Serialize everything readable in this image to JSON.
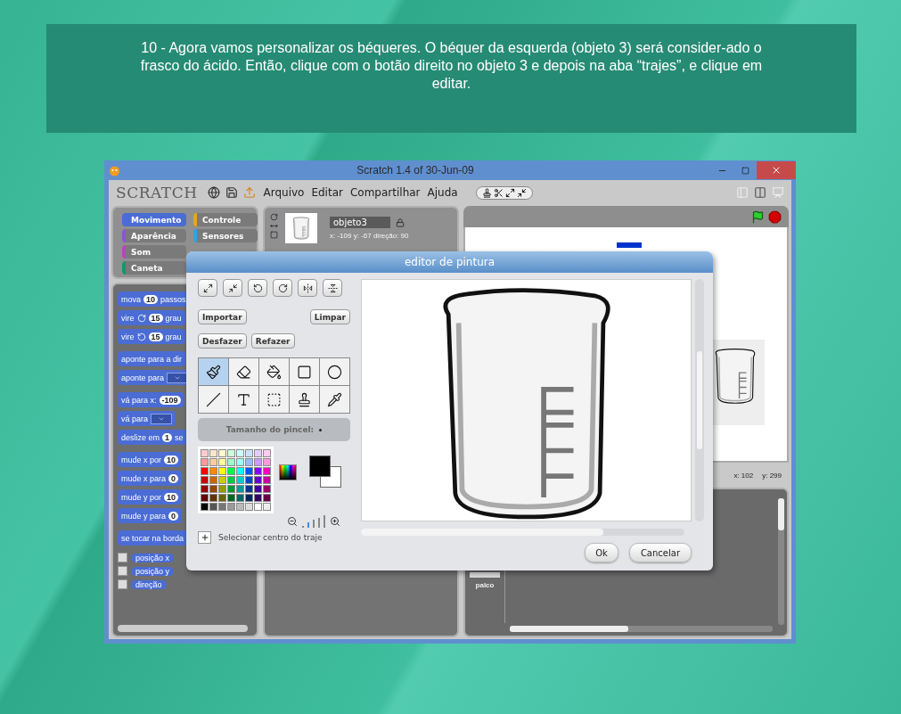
{
  "caption": "10 - Agora vamos personalizar os béqueres. O béquer da esquerda (objeto 3) será consider-ado o frasco do ácido. Então, clique com o botão direito no objeto 3 e depois na aba “trajes”, e clique em editar.",
  "window": {
    "title": "Scratch 1.4 of 30-Jun-09"
  },
  "logo": "SCRATCH",
  "menu": [
    "Arquivo",
    "Editar",
    "Compartilhar",
    "Ajuda"
  ],
  "categories": [
    {
      "label": "Movimento",
      "color": "#4a6cd4",
      "selected": true
    },
    {
      "label": "Aparência",
      "color": "#8a55d7",
      "selected": false
    },
    {
      "label": "Som",
      "color": "#bb42c3",
      "selected": false
    },
    {
      "label": "Caneta",
      "color": "#0e9a6c",
      "selected": false
    },
    {
      "label": "Controle",
      "color": "#e1a91a",
      "selected": false
    },
    {
      "label": "Sensores",
      "color": "#2ca5e2",
      "selected": false
    }
  ],
  "block_groups": [
    {
      "blocks": [
        {
          "parts": [
            {
              "kind": "text",
              "text": "mova"
            },
            {
              "kind": "input",
              "text": "10"
            },
            {
              "kind": "text",
              "text": "passos"
            }
          ]
        },
        {
          "parts": [
            {
              "kind": "text",
              "text": "vire"
            },
            {
              "kind": "turn_right"
            },
            {
              "kind": "input",
              "text": "15"
            },
            {
              "kind": "text",
              "text": "grau"
            }
          ]
        },
        {
          "parts": [
            {
              "kind": "text",
              "text": "vire"
            },
            {
              "kind": "turn_left"
            },
            {
              "kind": "input",
              "text": "15"
            },
            {
              "kind": "text",
              "text": "grau"
            }
          ]
        }
      ]
    },
    {
      "blocks": [
        {
          "parts": [
            {
              "kind": "text",
              "text": "aponte para a dir"
            }
          ]
        },
        {
          "parts": [
            {
              "kind": "text",
              "text": "aponte para"
            },
            {
              "kind": "dropdown"
            }
          ]
        }
      ]
    },
    {
      "blocks": [
        {
          "parts": [
            {
              "kind": "text",
              "text": "vá para x:"
            },
            {
              "kind": "input",
              "text": "-109"
            }
          ]
        },
        {
          "parts": [
            {
              "kind": "text",
              "text": "vá para"
            },
            {
              "kind": "dropdown"
            }
          ]
        },
        {
          "parts": [
            {
              "kind": "text",
              "text": "deslize em"
            },
            {
              "kind": "input",
              "text": "1"
            },
            {
              "kind": "text",
              "text": "se"
            }
          ]
        }
      ]
    },
    {
      "blocks": [
        {
          "parts": [
            {
              "kind": "text",
              "text": "mude x por"
            },
            {
              "kind": "input",
              "text": "10"
            }
          ]
        },
        {
          "parts": [
            {
              "kind": "text",
              "text": "mude x para"
            },
            {
              "kind": "input",
              "text": "0"
            }
          ]
        },
        {
          "parts": [
            {
              "kind": "text",
              "text": "mude y por"
            },
            {
              "kind": "input",
              "text": "10"
            }
          ]
        },
        {
          "parts": [
            {
              "kind": "text",
              "text": "mude y para"
            },
            {
              "kind": "input",
              "text": "0"
            }
          ]
        }
      ]
    },
    {
      "blocks": [
        {
          "parts": [
            {
              "kind": "text",
              "text": "se tocar na borda"
            }
          ]
        }
      ]
    }
  ],
  "reporters": [
    {
      "label": "posição x",
      "checked": false
    },
    {
      "label": "posição y",
      "checked": false
    },
    {
      "label": "direção",
      "checked": false
    }
  ],
  "sprite": {
    "name": "objeto3",
    "stats": "x: -109 y: -67 direção: 90"
  },
  "stage": {
    "mouse_x": "x: 102",
    "mouse_y": "y: 299"
  },
  "sprites_pane": {
    "stage_label": "palco"
  },
  "paint_editor": {
    "title": "editor de pintura",
    "transforms": [
      {
        "kind": "grow"
      },
      {
        "kind": "shrink"
      },
      {
        "kind": "rotate_left"
      },
      {
        "kind": "rotate_right"
      },
      {
        "kind": "flip_horizontal"
      },
      {
        "kind": "flip_vertical"
      }
    ],
    "import": "Importar",
    "clear": "Limpar",
    "undo": "Desfazer",
    "redo": "Refazer",
    "tools": [
      {
        "kind": "brush",
        "selected": true
      },
      {
        "kind": "eraser",
        "selected": false
      },
      {
        "kind": "fill",
        "selected": false
      },
      {
        "kind": "rectangle",
        "selected": false
      },
      {
        "kind": "ellipse",
        "selected": false
      },
      {
        "kind": "line",
        "selected": false
      },
      {
        "kind": "text",
        "selected": false
      },
      {
        "kind": "select",
        "selected": false
      },
      {
        "kind": "stamp",
        "selected": false
      },
      {
        "kind": "eyedropper",
        "selected": false
      }
    ],
    "brush_size_label": "Tamanho do pincel:",
    "palette": [
      {
        "color": "#ffcccc"
      },
      {
        "color": "#ffe5cc"
      },
      {
        "color": "#ffffcc"
      },
      {
        "color": "#ccffdd"
      },
      {
        "color": "#ccffff"
      },
      {
        "color": "#cce0ff"
      },
      {
        "color": "#e5ccff"
      },
      {
        "color": "#ffccf0"
      },
      {
        "color": "#ff9999"
      },
      {
        "color": "#ffcc99"
      },
      {
        "color": "#ffff99"
      },
      {
        "color": "#99ffcc"
      },
      {
        "color": "#99ffff"
      },
      {
        "color": "#99bbff"
      },
      {
        "color": "#cc99ff"
      },
      {
        "color": "#ff99dd"
      },
      {
        "color": "#ff0000"
      },
      {
        "color": "#ff8800"
      },
      {
        "color": "#ffff00"
      },
      {
        "color": "#00ff44"
      },
      {
        "color": "#00ffff"
      },
      {
        "color": "#0055ff"
      },
      {
        "color": "#8800ff"
      },
      {
        "color": "#ff00bb"
      },
      {
        "color": "#cc0000"
      },
      {
        "color": "#cc6600"
      },
      {
        "color": "#cccc00"
      },
      {
        "color": "#00cc44"
      },
      {
        "color": "#00cccc"
      },
      {
        "color": "#0044cc"
      },
      {
        "color": "#6600cc"
      },
      {
        "color": "#cc0099"
      },
      {
        "color": "#990000"
      },
      {
        "color": "#994400"
      },
      {
        "color": "#999900"
      },
      {
        "color": "#009933"
      },
      {
        "color": "#009999"
      },
      {
        "color": "#003399"
      },
      {
        "color": "#440099"
      },
      {
        "color": "#990066"
      },
      {
        "color": "#660000"
      },
      {
        "color": "#663300"
      },
      {
        "color": "#666600"
      },
      {
        "color": "#006622"
      },
      {
        "color": "#006666"
      },
      {
        "color": "#002266"
      },
      {
        "color": "#330066"
      },
      {
        "color": "#660044"
      },
      {
        "color": "#000000"
      },
      {
        "color": "#555555"
      },
      {
        "color": "#777777"
      },
      {
        "color": "#999999"
      },
      {
        "color": "#bbbbbb"
      },
      {
        "color": "#dddddd"
      },
      {
        "color": "#ffffff"
      },
      {
        "color": "#eeeeee"
      }
    ],
    "current_colors": [
      {
        "kind": "foreground",
        "color": "#000000"
      },
      {
        "kind": "background",
        "color": "#ffffff"
      }
    ],
    "center_label": "Selecionar centro do traje",
    "ok": "Ok",
    "cancel": "Cancelar"
  }
}
